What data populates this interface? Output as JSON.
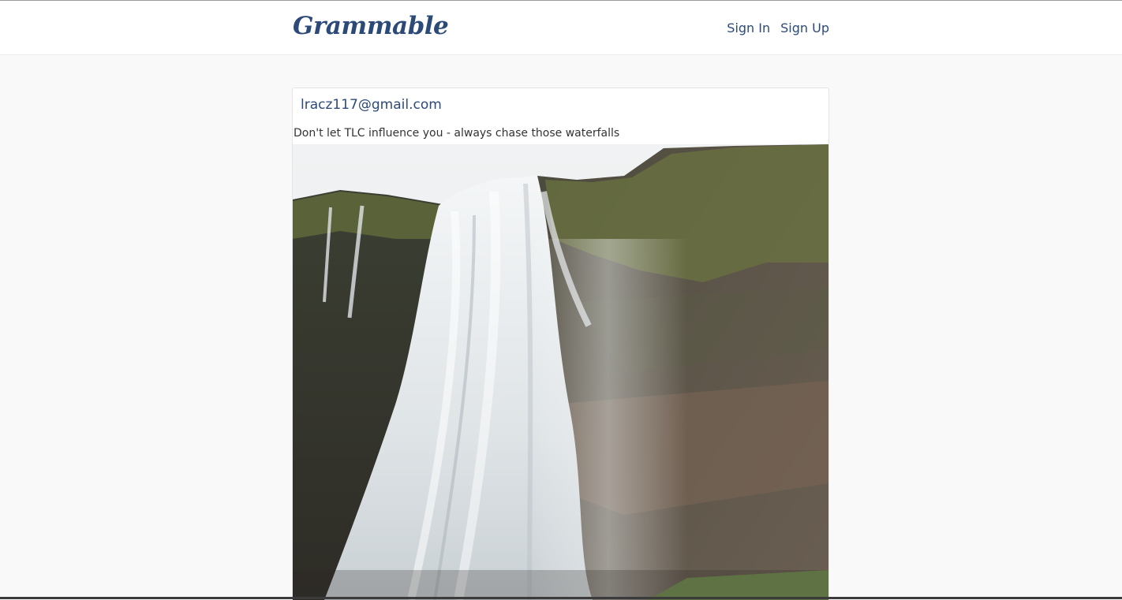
{
  "navbar": {
    "brand": "Grammable",
    "links": [
      {
        "label": "Sign In"
      },
      {
        "label": "Sign Up"
      }
    ]
  },
  "post": {
    "user_email": "lracz117@gmail.com",
    "caption": "Don't let TLC influence you - always chase those waterfalls",
    "image_subject": "waterfall-photo"
  },
  "colors": {
    "brand": "#2c4a78",
    "background": "#f9f9f9",
    "card": "#ffffff"
  }
}
